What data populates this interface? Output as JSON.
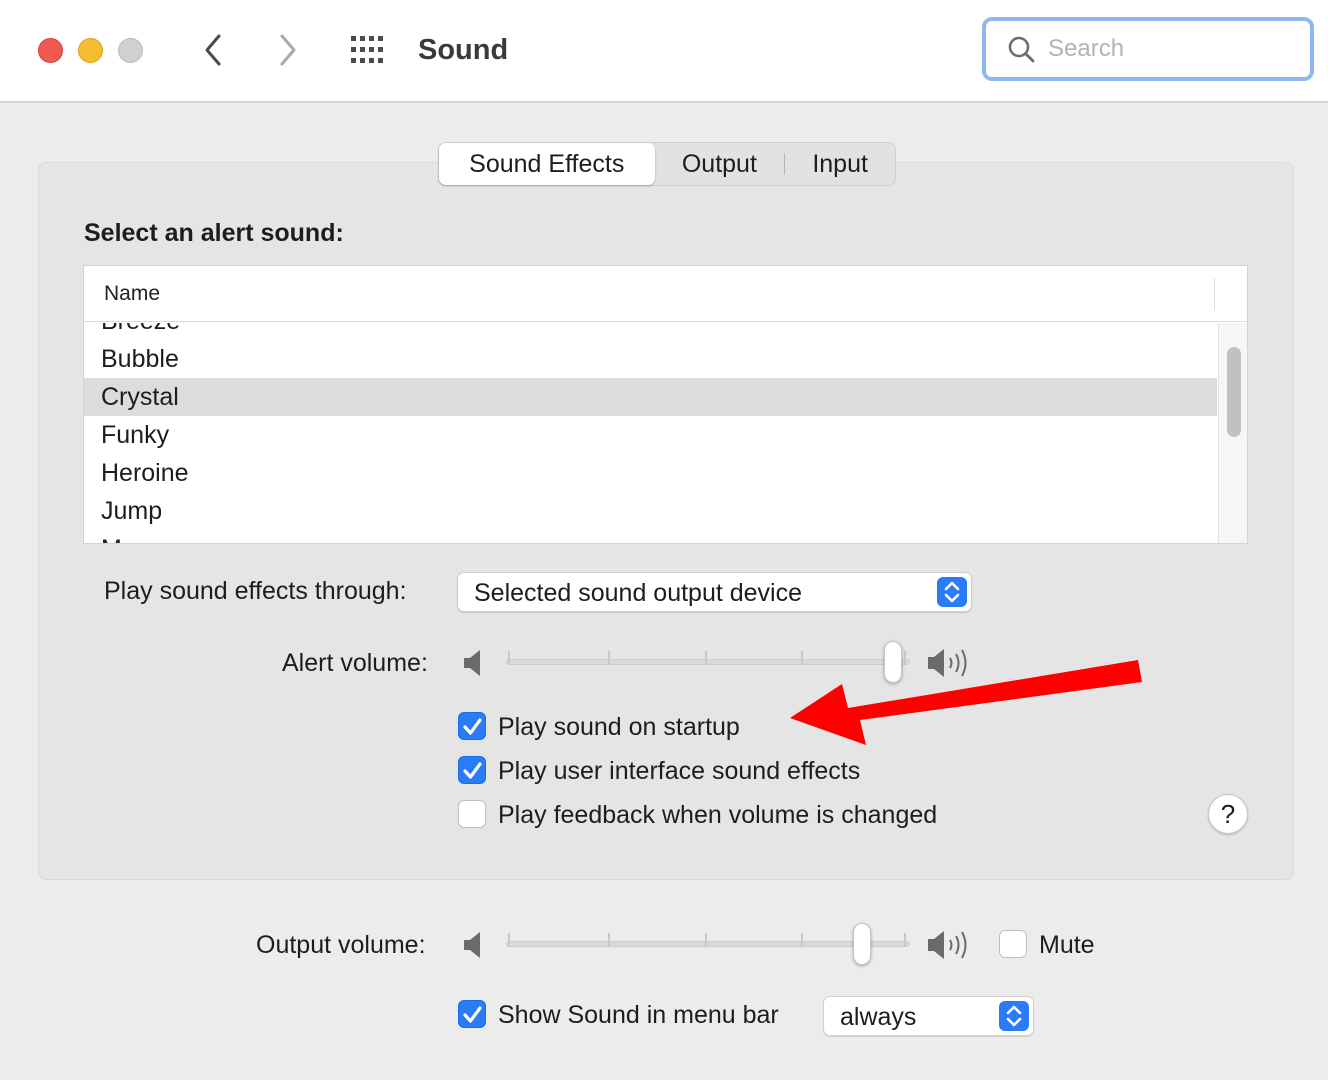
{
  "window": {
    "title": "Sound"
  },
  "search": {
    "placeholder": "Search",
    "value": ""
  },
  "tabs": [
    {
      "label": "Sound Effects",
      "selected": true
    },
    {
      "label": "Output",
      "selected": false
    },
    {
      "label": "Input",
      "selected": false
    }
  ],
  "alert_sound": {
    "label": "Select an alert sound:",
    "column_header": "Name",
    "items": [
      "Breeze",
      "Bubble",
      "Crystal",
      "Funky",
      "Heroine",
      "Jump",
      "Morse"
    ],
    "selected": "Crystal"
  },
  "play_through": {
    "label": "Play sound effects through:",
    "value": "Selected sound output device"
  },
  "alert_volume": {
    "label": "Alert volume:",
    "level": 0.98
  },
  "checkboxes": {
    "startup": {
      "label": "Play sound on startup",
      "checked": true
    },
    "ui_effects": {
      "label": "Play user interface sound effects",
      "checked": true
    },
    "feedback": {
      "label": "Play feedback when volume is changed",
      "checked": false
    }
  },
  "help": {
    "label": "?"
  },
  "output_volume": {
    "label": "Output volume:",
    "level": 0.9
  },
  "mute": {
    "label": "Mute",
    "checked": false
  },
  "menu_bar": {
    "label": "Show Sound in menu bar",
    "checked": true,
    "value": "always"
  },
  "colors": {
    "accent": "#2a7bf6",
    "annotation_arrow": "#ff0000"
  },
  "icons": [
    "chevron-left-icon",
    "chevron-right-icon",
    "grid-icon",
    "search-icon",
    "speaker-low-icon",
    "speaker-high-icon",
    "checkmark-icon",
    "stepper-icon"
  ]
}
